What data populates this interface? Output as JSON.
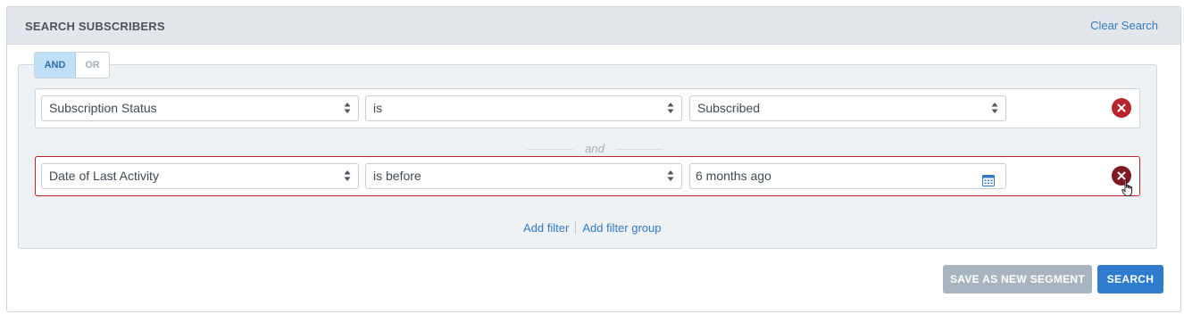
{
  "header": {
    "title": "SEARCH SUBSCRIBERS",
    "clear_label": "Clear Search"
  },
  "logic_toggle": {
    "and_label": "AND",
    "or_label": "OR",
    "selected": "AND"
  },
  "filters": [
    {
      "field": "Subscription Status",
      "operator": "is",
      "value": "Subscribed",
      "value_type": "select"
    },
    {
      "field": "Date of Last Activity",
      "operator": "is before",
      "value": "6 months ago",
      "value_type": "date"
    }
  ],
  "separator_label": "and",
  "links": {
    "add_filter": "Add filter",
    "add_filter_group": "Add filter group"
  },
  "buttons": {
    "save_segment": "SAVE AS NEW SEGMENT",
    "search": "SEARCH"
  },
  "icons": {
    "remove": "close-circle-icon",
    "calendar": "calendar-icon",
    "select_arrows": "sort-arrows-icon",
    "cursor": "hand-pointer-icon"
  },
  "colors": {
    "accent": "#2f7ccf",
    "link": "#2f7bc1",
    "danger": "#b8232c",
    "disabled_button": "#a8b5c0",
    "toggle_selected": "#bfe0f7"
  }
}
